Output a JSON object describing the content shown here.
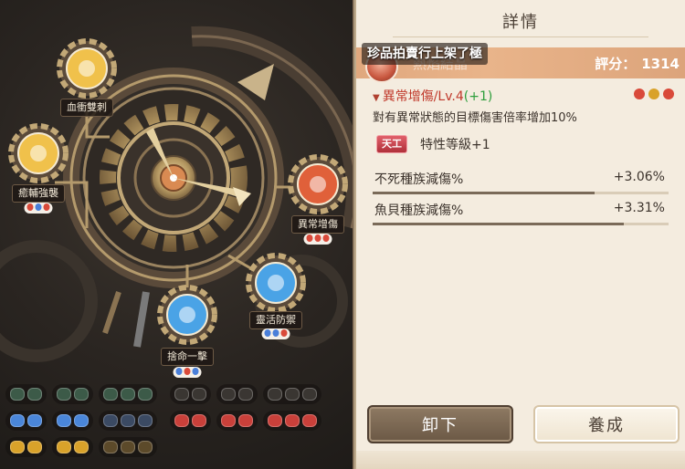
{
  "panel": {
    "title": "詳情",
    "marquee": "珍品拍賣行上架了極",
    "item_name": "熱焰結晶",
    "score_label": "評分：",
    "score_value": "1314",
    "trait": {
      "name": "異常增傷/Lv.4",
      "bonus": "(+1)",
      "description": "對有異常狀態的目標傷害倍率增加10%",
      "dot_colors": [
        "#d94a3a",
        "#d9a22a",
        "#d94a3a"
      ]
    },
    "badge": {
      "label": "天工",
      "text": "特性等級+1"
    },
    "stats": [
      {
        "name": "不死種族減傷%",
        "value": "+3.06%",
        "fill": 0.75
      },
      {
        "name": "魚貝種族減傷%",
        "value": "+3.31%",
        "fill": 0.85
      }
    ],
    "buttons": {
      "unequip": "卸下",
      "upgrade": "養成"
    }
  },
  "mechanism": {
    "nodes": [
      {
        "label": "血衝雙刺",
        "icon": "twin-blade-icon",
        "color": "#f0c14b",
        "dots": []
      },
      {
        "label": "癒輔強襲",
        "icon": "flame-icon",
        "color": "#f0c14b",
        "dots": [
          "#d94a3a",
          "#4a7fd9",
          "#d94a3a"
        ]
      },
      {
        "label": "異常增傷",
        "icon": "crown-icon",
        "color": "#e0603a",
        "dots": [
          "#d94a3a",
          "#d94a3a",
          "#d94a3a"
        ]
      },
      {
        "label": "靈活防禦",
        "icon": "star-icon",
        "color": "#4aa3e6",
        "dots": [
          "#4a7fd9",
          "#4a7fd9",
          "#d94a3a"
        ]
      },
      {
        "label": "捨命一擊",
        "icon": "lightning-icon",
        "color": "#4aa3e6",
        "dots": [
          "#4a7fd9",
          "#d94a3a",
          "#4a7fd9"
        ]
      }
    ],
    "slot_rows": [
      {
        "groups": [
          {
            "n": 2,
            "color": "#3c5a48"
          },
          {
            "n": 2,
            "color": "#3c5a48"
          },
          {
            "n": 3,
            "color": "#3c5a48"
          },
          {
            "n": 2,
            "color": "#3a3632"
          },
          {
            "n": 2,
            "color": "#3a3632"
          },
          {
            "n": 3,
            "color": "#3a3632"
          }
        ]
      },
      {
        "groups": [
          {
            "n": 2,
            "color": "#4a86d9"
          },
          {
            "n": 2,
            "color": "#4a86d9"
          },
          {
            "n": 3,
            "color": "#3b4a63"
          },
          {
            "n": 2,
            "color": "#c9403a"
          },
          {
            "n": 2,
            "color": "#c9403a"
          },
          {
            "n": 3,
            "color": "#c9403a"
          }
        ]
      },
      {
        "groups": [
          {
            "n": 2,
            "color": "#d9a22a"
          },
          {
            "n": 2,
            "color": "#d9a22a"
          },
          {
            "n": 3,
            "color": "#5c4a2a"
          }
        ]
      }
    ]
  }
}
